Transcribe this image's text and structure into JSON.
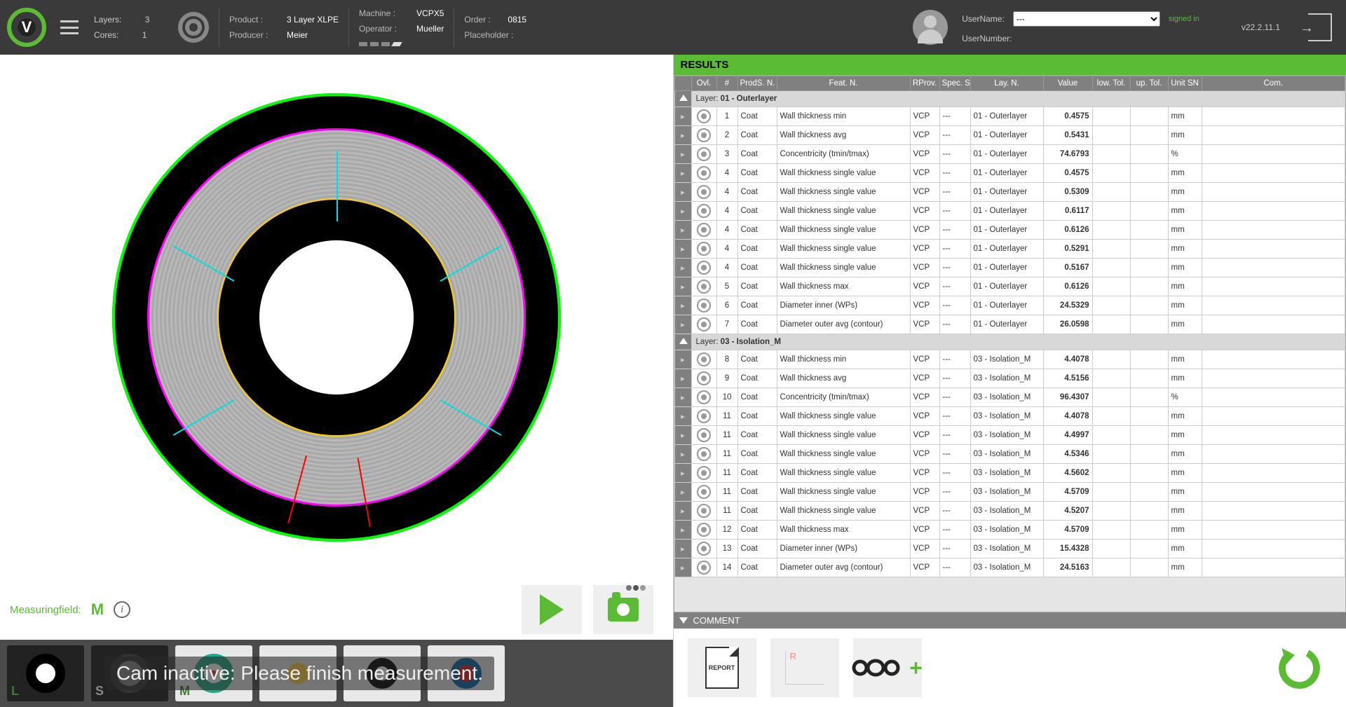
{
  "header": {
    "layers_label": "Layers:",
    "layers_value": "3",
    "cores_label": "Cores:",
    "cores_value": "1",
    "product_label": "Product :",
    "product_value": "3 Layer XLPE",
    "producer_label": "Producer :",
    "producer_value": "Meier",
    "machine_label": "Machine :",
    "machine_value": "VCPX5",
    "operator_label": "Operator :",
    "operator_value": "Mueller",
    "order_label": "Order :",
    "order_value": "0815",
    "placeholder_label": "Placeholder :",
    "placeholder_value": "",
    "username_label": "UserName:",
    "username_value": "---",
    "usernumber_label": "UserNumber:",
    "signed_in": "signed in",
    "version": "v22.2.11.1"
  },
  "measuring": {
    "label": "Measuringfield:",
    "value": "M"
  },
  "overlay_message": "Cam inactive: Please finish measurement.",
  "thumbs": [
    "L",
    "S",
    "M",
    "",
    ""
  ],
  "results_title": "RESULTS",
  "columns": {
    "ovl": "Ovl.",
    "num": "#",
    "prod": "ProdS. N.",
    "feat": "Feat. N.",
    "rprov": "RProv.",
    "spec": "Spec. SN",
    "lay": "Lay. N.",
    "val": "Value",
    "ltol": "low. Tol.",
    "utol": "up. Tol.",
    "unit": "Unit SN",
    "com": "Com."
  },
  "groups": [
    {
      "label_prefix": "Layer:",
      "label_name": "01 - Outerlayer",
      "rows": [
        {
          "n": "1",
          "prod": "Coat",
          "feat": "Wall thickness min",
          "rp": "VCP",
          "sp": "---",
          "lay": "01 - Outerlayer",
          "val": "0.4575",
          "unit": "mm"
        },
        {
          "n": "2",
          "prod": "Coat",
          "feat": "Wall thickness avg",
          "rp": "VCP",
          "sp": "---",
          "lay": "01 - Outerlayer",
          "val": "0.5431",
          "unit": "mm"
        },
        {
          "n": "3",
          "prod": "Coat",
          "feat": "Concentricity (tmin/tmax)",
          "rp": "VCP",
          "sp": "---",
          "lay": "01 - Outerlayer",
          "val": "74.6793",
          "unit": "%"
        },
        {
          "n": "4",
          "prod": "Coat",
          "feat": "Wall thickness single value",
          "rp": "VCP",
          "sp": "---",
          "lay": "01 - Outerlayer",
          "val": "0.4575",
          "unit": "mm"
        },
        {
          "n": "4",
          "prod": "Coat",
          "feat": "Wall thickness single value",
          "rp": "VCP",
          "sp": "---",
          "lay": "01 - Outerlayer",
          "val": "0.5309",
          "unit": "mm"
        },
        {
          "n": "4",
          "prod": "Coat",
          "feat": "Wall thickness single value",
          "rp": "VCP",
          "sp": "---",
          "lay": "01 - Outerlayer",
          "val": "0.6117",
          "unit": "mm"
        },
        {
          "n": "4",
          "prod": "Coat",
          "feat": "Wall thickness single value",
          "rp": "VCP",
          "sp": "---",
          "lay": "01 - Outerlayer",
          "val": "0.6126",
          "unit": "mm"
        },
        {
          "n": "4",
          "prod": "Coat",
          "feat": "Wall thickness single value",
          "rp": "VCP",
          "sp": "---",
          "lay": "01 - Outerlayer",
          "val": "0.5291",
          "unit": "mm"
        },
        {
          "n": "4",
          "prod": "Coat",
          "feat": "Wall thickness single value",
          "rp": "VCP",
          "sp": "---",
          "lay": "01 - Outerlayer",
          "val": "0.5167",
          "unit": "mm"
        },
        {
          "n": "5",
          "prod": "Coat",
          "feat": "Wall thickness max",
          "rp": "VCP",
          "sp": "---",
          "lay": "01 - Outerlayer",
          "val": "0.6126",
          "unit": "mm"
        },
        {
          "n": "6",
          "prod": "Coat",
          "feat": "Diameter inner (WPs)",
          "rp": "VCP",
          "sp": "---",
          "lay": "01 - Outerlayer",
          "val": "24.5329",
          "unit": "mm"
        },
        {
          "n": "7",
          "prod": "Coat",
          "feat": "Diameter outer avg (contour)",
          "rp": "VCP",
          "sp": "---",
          "lay": "01 - Outerlayer",
          "val": "26.0598",
          "unit": "mm"
        }
      ]
    },
    {
      "label_prefix": "Layer:",
      "label_name": "03 - Isolation_M",
      "rows": [
        {
          "n": "8",
          "prod": "Coat",
          "feat": "Wall thickness min",
          "rp": "VCP",
          "sp": "---",
          "lay": "03 - Isolation_M",
          "val": "4.4078",
          "unit": "mm"
        },
        {
          "n": "9",
          "prod": "Coat",
          "feat": "Wall thickness avg",
          "rp": "VCP",
          "sp": "---",
          "lay": "03 - Isolation_M",
          "val": "4.5156",
          "unit": "mm"
        },
        {
          "n": "10",
          "prod": "Coat",
          "feat": "Concentricity (tmin/tmax)",
          "rp": "VCP",
          "sp": "---",
          "lay": "03 - Isolation_M",
          "val": "96.4307",
          "unit": "%"
        },
        {
          "n": "11",
          "prod": "Coat",
          "feat": "Wall thickness single value",
          "rp": "VCP",
          "sp": "---",
          "lay": "03 - Isolation_M",
          "val": "4.4078",
          "unit": "mm"
        },
        {
          "n": "11",
          "prod": "Coat",
          "feat": "Wall thickness single value",
          "rp": "VCP",
          "sp": "---",
          "lay": "03 - Isolation_M",
          "val": "4.4997",
          "unit": "mm"
        },
        {
          "n": "11",
          "prod": "Coat",
          "feat": "Wall thickness single value",
          "rp": "VCP",
          "sp": "---",
          "lay": "03 - Isolation_M",
          "val": "4.5346",
          "unit": "mm"
        },
        {
          "n": "11",
          "prod": "Coat",
          "feat": "Wall thickness single value",
          "rp": "VCP",
          "sp": "---",
          "lay": "03 - Isolation_M",
          "val": "4.5602",
          "unit": "mm"
        },
        {
          "n": "11",
          "prod": "Coat",
          "feat": "Wall thickness single value",
          "rp": "VCP",
          "sp": "---",
          "lay": "03 - Isolation_M",
          "val": "4.5709",
          "unit": "mm"
        },
        {
          "n": "11",
          "prod": "Coat",
          "feat": "Wall thickness single value",
          "rp": "VCP",
          "sp": "---",
          "lay": "03 - Isolation_M",
          "val": "4.5207",
          "unit": "mm"
        },
        {
          "n": "12",
          "prod": "Coat",
          "feat": "Wall thickness max",
          "rp": "VCP",
          "sp": "---",
          "lay": "03 - Isolation_M",
          "val": "4.5709",
          "unit": "mm"
        },
        {
          "n": "13",
          "prod": "Coat",
          "feat": "Diameter inner (WPs)",
          "rp": "VCP",
          "sp": "---",
          "lay": "03 - Isolation_M",
          "val": "15.4328",
          "unit": "mm"
        },
        {
          "n": "14",
          "prod": "Coat",
          "feat": "Diameter outer avg (contour)",
          "rp": "VCP",
          "sp": "---",
          "lay": "03 - Isolation_M",
          "val": "24.5163",
          "unit": "mm"
        }
      ]
    }
  ],
  "comment_label": "COMMENT",
  "report_label": "REPORT"
}
